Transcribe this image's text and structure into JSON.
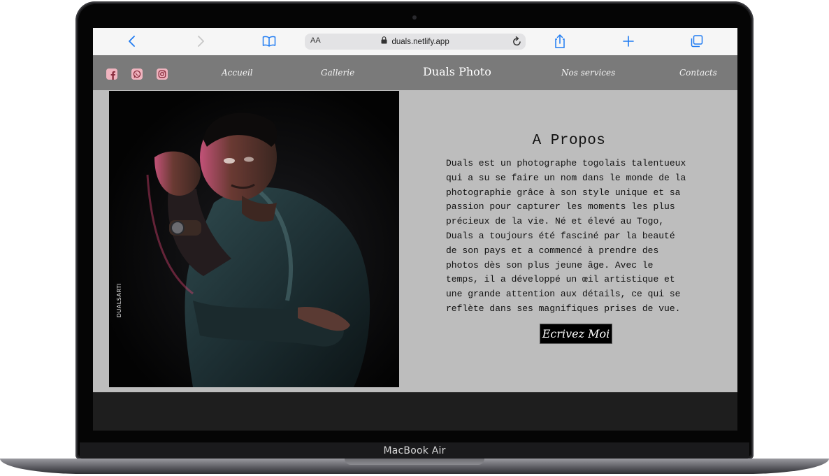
{
  "device": {
    "model_label": "MacBook Air"
  },
  "browser": {
    "address_bar": {
      "text_size_label": "AA",
      "url": "duals.netlify.app"
    },
    "icons": [
      "chevron-left-icon",
      "chevron-right-icon",
      "book-icon",
      "lock-icon",
      "reload-icon",
      "share-icon",
      "plus-icon",
      "tabs-icon"
    ]
  },
  "site": {
    "brand": "Duals Photo",
    "nav": {
      "accueil": "Accueil",
      "gallerie": "Gallerie",
      "services": "Nos services",
      "contacts": "Contacts"
    },
    "social_icons": [
      "facebook-icon",
      "whatsapp-icon",
      "instagram-icon"
    ],
    "about": {
      "title": "A Propos",
      "lines": [
        "Duals est un photographe togolais talentueux",
        "qui a su se faire un nom dans le monde de la",
        "photographie grâce à son style unique et sa",
        "passion pour capturer les moments les plus",
        "précieux de la vie. Né et élevé au Togo,",
        "Duals a toujours été fasciné par la beauté",
        "de son pays et a commencé à prendre des",
        "photos dès son plus jeune âge. Avec le",
        "temps, il a développé un œil artistique et",
        "une grande attention aux détails, ce qui se",
        "reflète dans ses magnifiques prises de vue."
      ],
      "cta": "Ecrivez Moi"
    },
    "photo": {
      "watermark": "DUALSARTI"
    }
  },
  "colors": {
    "nav_bg": "#7a7a7a",
    "content_bg": "#bdbdbd",
    "footer_bg": "#1e1e1e",
    "accent_blue": "#1f7bf2",
    "social_pink": "#f0b4bf"
  }
}
